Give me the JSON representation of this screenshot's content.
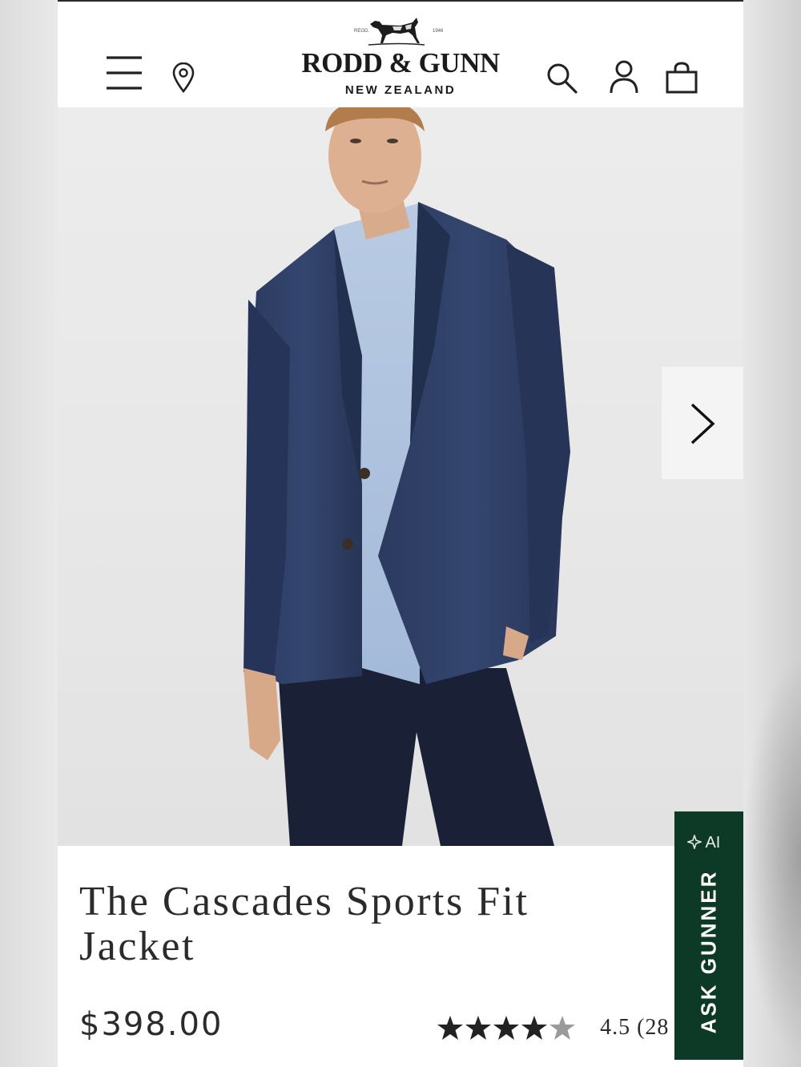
{
  "header": {
    "brand_name": "RODD & GUNN",
    "brand_sub": "NEW ZEALAND",
    "logo_regd": "REGD.",
    "logo_year": "1946",
    "icons": [
      "menu-icon",
      "location-pin-icon",
      "search-icon",
      "account-icon",
      "bag-icon"
    ]
  },
  "gallery": {
    "next_icon": "chevron-right-icon"
  },
  "product": {
    "title": "The Cascades Sports Fit Jacket",
    "price": "$398.00",
    "rating_value": 4.5,
    "rating_max": 5,
    "rating_text": "4.5 (28"
  },
  "assistant": {
    "ai_label": "AI",
    "ai_icon": "sparkle-icon",
    "button_label": "ASK GUNNER",
    "bg_color": "#0d3a26"
  },
  "colors": {
    "text": "#2b2b2b",
    "background": "#ffffff",
    "hero_bg": "#e7e7e7",
    "jacket": "#2f3f66"
  }
}
